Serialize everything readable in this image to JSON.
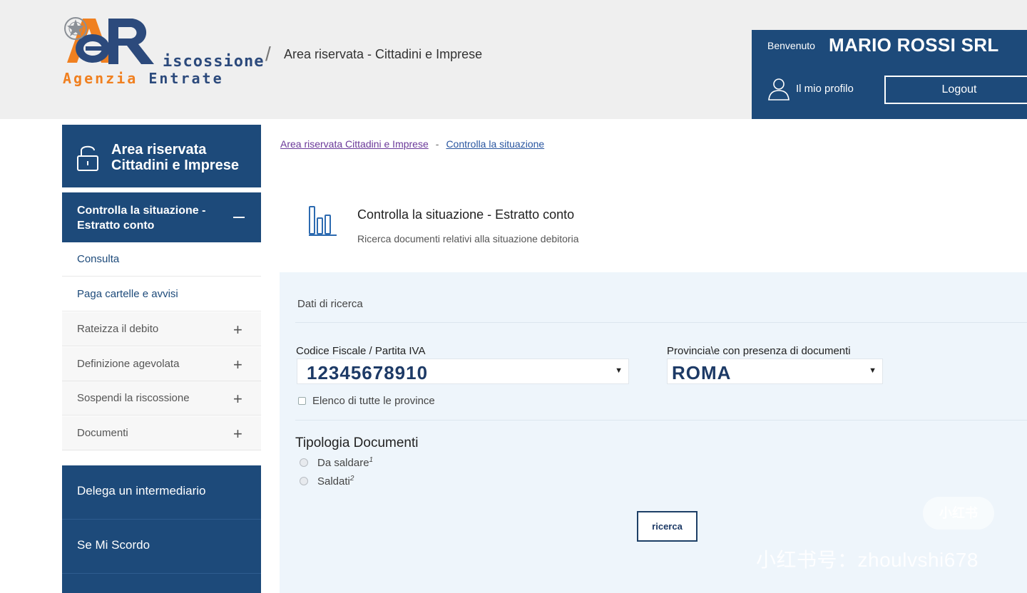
{
  "header": {
    "logo": {
      "letters": "aeR",
      "word": "iscossione",
      "agency_part1": "Agenzia",
      "agency_part2": "Entrate"
    },
    "section_title": "Area riservata - Cittadini e Imprese",
    "user": {
      "welcome": "Benvenuto",
      "name": "MARIO ROSSI SRL",
      "profile_label": "Il mio profilo",
      "logout_label": "Logout"
    }
  },
  "sidebar": {
    "head": "Area riservata Cittadini e Imprese",
    "active": "Controlla la situazione - Estratto conto",
    "sub_items": [
      "Consulta",
      "Paga cartelle e avvisi"
    ],
    "items": [
      "Rateizza il debito",
      "Definizione agevolata",
      "Sospendi la riscossione",
      "Documenti"
    ],
    "big_items": [
      "Delega un intermediario",
      "Se Mi Scordo"
    ]
  },
  "breadcrumb": {
    "item1": "Area riservata Cittadini e Imprese",
    "separator": "-",
    "item2": "Controlla la situazione"
  },
  "main": {
    "title": "Controlla la situazione - Estratto conto",
    "subtitle": "Ricerca documenti relativi alla situazione debitoria",
    "panel_title": "Dati di ricerca",
    "cf_label": "Codice Fiscale / Partita IVA",
    "cf_value": "12345678910",
    "prov_label": "Provincia\\e con presenza di documenti",
    "prov_value": "ROMA",
    "checkbox_label": "Elenco di tutte le province",
    "tipologia_title": "Tipologia Documenti",
    "radio1": "Da saldare",
    "radio1_sup": "1",
    "radio2": "Saldati",
    "radio2_sup": "2",
    "search_button": "ricerca"
  },
  "watermark": {
    "badge": "小红书",
    "text": "小红书号：zhoulvshi678"
  },
  "colors": {
    "primary": "#1d4a7a",
    "panel_bg": "#eef5fb",
    "header_bg": "#efefef",
    "logo_orange": "#f08020"
  }
}
